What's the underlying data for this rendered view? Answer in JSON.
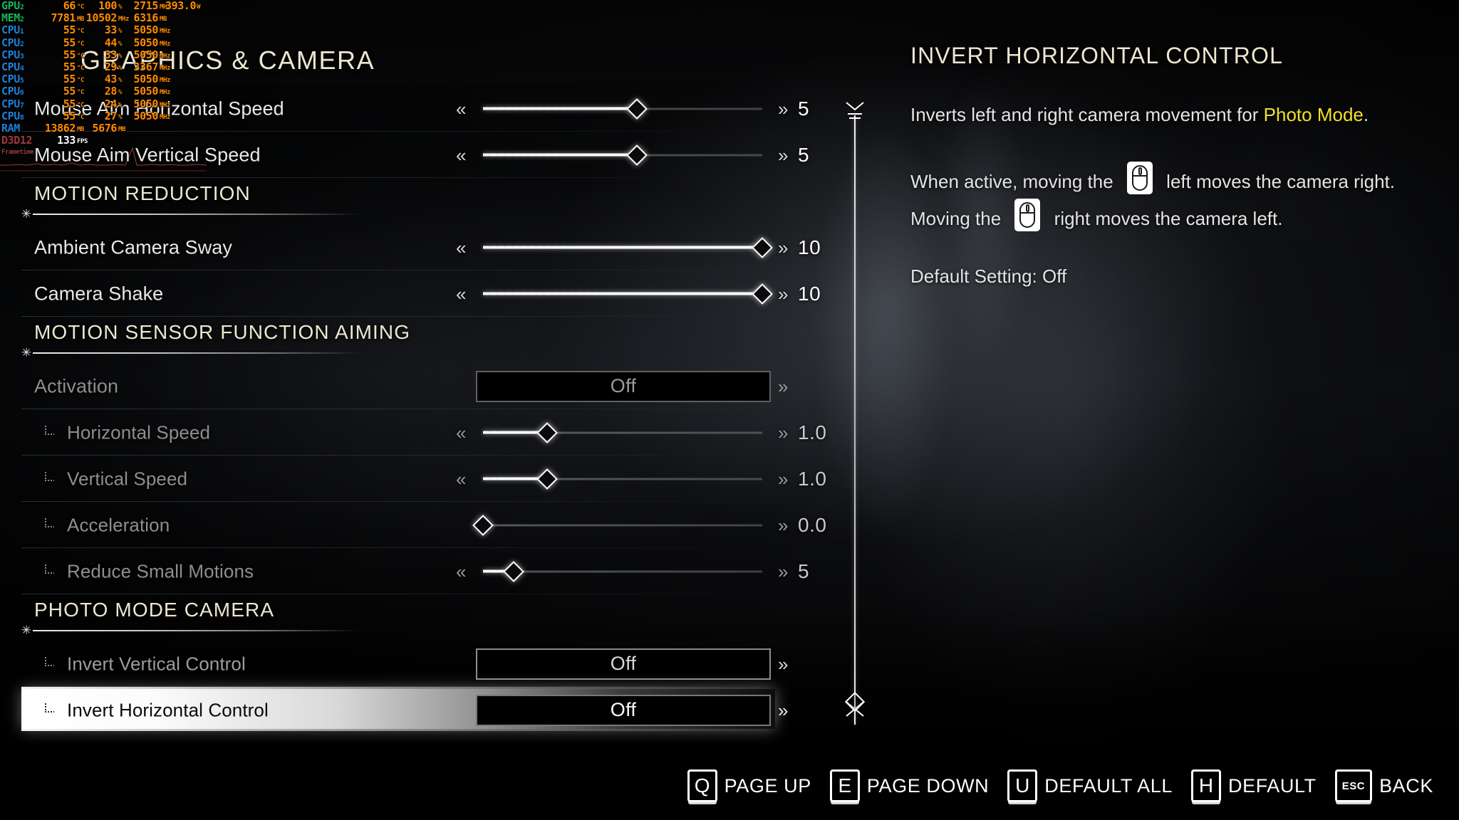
{
  "page_title": "GRAPHICS & CAMERA",
  "hwmon": {
    "rows": [
      {
        "label": "GPU",
        "sub": "2",
        "color": "green",
        "values": [
          {
            "v": "66",
            "u": "°C"
          },
          {
            "v": "100",
            "u": "%"
          },
          {
            "v": "2715",
            "u": "MHz"
          },
          {
            "v": "393.0",
            "u": "W"
          }
        ]
      },
      {
        "label": "MEM",
        "sub": "2",
        "color": "green",
        "values": [
          {
            "v": "7781",
            "u": "MB"
          },
          {
            "v": "10502",
            "u": "MHz"
          },
          {
            "v": "6316",
            "u": "MB"
          }
        ]
      },
      {
        "label": "CPU",
        "sub": "1",
        "color": "blue",
        "values": [
          {
            "v": "55",
            "u": "°C"
          },
          {
            "v": "33",
            "u": "%"
          },
          {
            "v": "5050",
            "u": "MHz"
          }
        ]
      },
      {
        "label": "CPU",
        "sub": "2",
        "color": "blue",
        "values": [
          {
            "v": "55",
            "u": "°C"
          },
          {
            "v": "44",
            "u": "%"
          },
          {
            "v": "5050",
            "u": "MHz"
          }
        ]
      },
      {
        "label": "CPU",
        "sub": "3",
        "color": "blue",
        "values": [
          {
            "v": "55",
            "u": "°C"
          },
          {
            "v": "33",
            "u": "%"
          },
          {
            "v": "5050",
            "u": "MHz"
          }
        ]
      },
      {
        "label": "CPU",
        "sub": "4",
        "color": "blue",
        "values": [
          {
            "v": "55",
            "u": "°C"
          },
          {
            "v": "29",
            "u": "%"
          },
          {
            "v": "3367",
            "u": "MHz"
          }
        ]
      },
      {
        "label": "CPU",
        "sub": "5",
        "color": "blue",
        "values": [
          {
            "v": "55",
            "u": "°C"
          },
          {
            "v": "43",
            "u": "%"
          },
          {
            "v": "5050",
            "u": "MHz"
          }
        ]
      },
      {
        "label": "CPU",
        "sub": "6",
        "color": "blue",
        "values": [
          {
            "v": "55",
            "u": "°C"
          },
          {
            "v": "28",
            "u": "%"
          },
          {
            "v": "5050",
            "u": "MHz"
          }
        ]
      },
      {
        "label": "CPU",
        "sub": "7",
        "color": "blue",
        "values": [
          {
            "v": "55",
            "u": "°C"
          },
          {
            "v": "24",
            "u": "%"
          },
          {
            "v": "5050",
            "u": "MHz"
          }
        ]
      },
      {
        "label": "CPU",
        "sub": "8",
        "color": "blue",
        "values": [
          {
            "v": "55",
            "u": "°C"
          },
          {
            "v": "27",
            "u": "%"
          },
          {
            "v": "5050",
            "u": "MHz"
          }
        ]
      },
      {
        "label": "RAM",
        "sub": "",
        "color": "blue",
        "values": [
          {
            "v": "13862",
            "u": "MB"
          },
          {
            "v": "5676",
            "u": "MB"
          }
        ]
      }
    ],
    "api": "D3D12",
    "fps": "133",
    "fps_unit": "FPS",
    "frametime_label": "Frametime"
  },
  "list": [
    {
      "kind": "slider",
      "label": "Mouse Aim Horizontal Speed",
      "value": "5",
      "pct": 55,
      "style": "normal"
    },
    {
      "kind": "slider",
      "label": "Mouse Aim Vertical Speed",
      "value": "5",
      "pct": 55,
      "style": "normal"
    },
    {
      "kind": "section",
      "label": "MOTION REDUCTION"
    },
    {
      "kind": "slider",
      "label": "Ambient Camera Sway",
      "value": "10",
      "pct": 100,
      "style": "normal"
    },
    {
      "kind": "slider",
      "label": "Camera Shake",
      "value": "10",
      "pct": 100,
      "style": "normal"
    },
    {
      "kind": "section",
      "label": "MOTION SENSOR FUNCTION AIMING"
    },
    {
      "kind": "dropdown",
      "label": "Activation",
      "value": "Off",
      "style": "dim",
      "indent": false
    },
    {
      "kind": "slider",
      "label": "Horizontal Speed",
      "value": "1.0",
      "pct": 23,
      "style": "dim",
      "indent": true
    },
    {
      "kind": "slider",
      "label": "Vertical Speed",
      "value": "1.0",
      "pct": 23,
      "style": "dim",
      "indent": true
    },
    {
      "kind": "slider",
      "label": "Acceleration",
      "value": "0.0",
      "pct": 0,
      "style": "dim",
      "indent": true,
      "no_left_arrow": true
    },
    {
      "kind": "slider",
      "label": "Reduce Small Motions",
      "value": "5",
      "pct": 11,
      "style": "dim",
      "indent": true
    },
    {
      "kind": "section",
      "label": "PHOTO MODE CAMERA"
    },
    {
      "kind": "dropdown",
      "label": "Invert Vertical Control",
      "value": "Off",
      "style": "normal",
      "indent": true
    },
    {
      "kind": "dropdown",
      "label": "Invert Horizontal Control",
      "value": "Off",
      "style": "selected",
      "indent": true
    }
  ],
  "slider_arrows": {
    "left": "«",
    "right": "»"
  },
  "info": {
    "title": "INVERT HORIZONTAL CONTROL",
    "para1_before": "Inverts left and right camera movement for ",
    "para1_highlight": "Photo Mode",
    "para1_after": ".",
    "para2_a": "When active, moving the",
    "para2_b": "left moves the camera right. Moving the",
    "para2_c": "right moves the camera left.",
    "default_setting": "Default Setting: Off"
  },
  "footer": [
    {
      "key": "Q",
      "label": "PAGE UP"
    },
    {
      "key": "E",
      "label": "PAGE DOWN"
    },
    {
      "key": "U",
      "label": "DEFAULT ALL"
    },
    {
      "key": "H",
      "label": "DEFAULT"
    },
    {
      "key": "ESC",
      "label": "BACK"
    }
  ],
  "colors": {
    "accent_cream": "#ece7cf",
    "highlight_yellow": "#f2e02a",
    "hw_orange": "#ff8c00",
    "hw_green": "#18b35a",
    "hw_blue": "#1f7fd6",
    "hw_api": "#9b3a3a"
  }
}
